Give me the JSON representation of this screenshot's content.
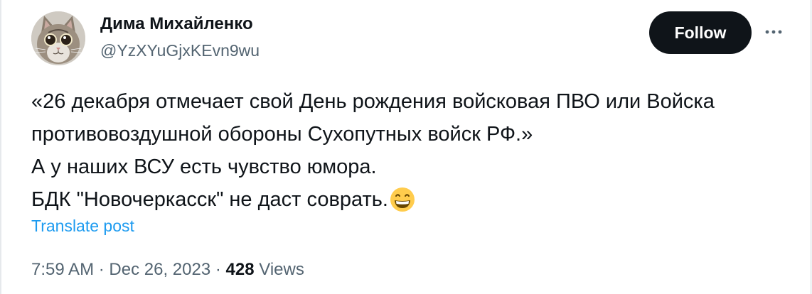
{
  "tweet": {
    "author": {
      "name": "Дима Михайленко",
      "handle": "@YzXYuGjxKEvn9wu",
      "avatar_icon": "cat-avatar"
    },
    "follow_label": "Follow",
    "more_icon": "more-options-icon",
    "text_lines": [
      "«26 декабря отмечает свой День рождения войсковая ПВО или Войска",
      "противовоздушной обороны Сухопутных войск РФ.»",
      "А у наших ВСУ есть чувство юмора.",
      "БДК  \"Новочеркасск\"  не даст соврать."
    ],
    "emoji": "grinning-face-emoji",
    "translate_label": "Translate post",
    "time": "7:59 AM",
    "date": "Dec 26, 2023",
    "separator": "·",
    "views_count": "428",
    "views_label": "Views"
  },
  "colors": {
    "text": "#0f1419",
    "secondary": "#536471",
    "link": "#1d9bf0",
    "button_bg": "#0f1419"
  }
}
